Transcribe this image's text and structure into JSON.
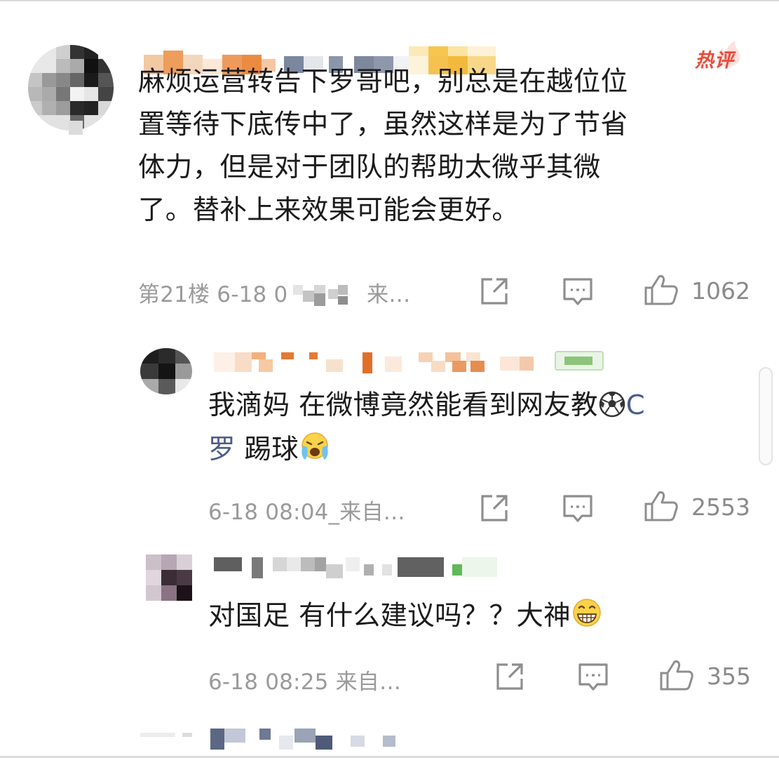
{
  "badge": {
    "hot_label": "热评"
  },
  "main_comment": {
    "text_lines": [
      "麻烦运营转告下罗哥吧，别总是在越位位",
      "置等待下底传中了，虽然这样是为了节省",
      "体力，但是对于团队的帮助太微乎其微",
      "了。替补上来效果可能会更好。"
    ],
    "meta": "第21楼 6-18 0",
    "meta_suffix": "来…",
    "like_count": "1062"
  },
  "replies": [
    {
      "text_line1_before": "我滴妈  在微博竟然能看到网友教",
      "mention_tail": "C",
      "mention_head": "罗",
      "text_line2_after": " 踢球",
      "meta": "6-18 08:04_来自…",
      "like_count": "2553"
    },
    {
      "text": "对国足 有什么建议吗？？大神",
      "meta": "6-18 08:25 来自…",
      "like_count": "355"
    }
  ],
  "icons": {
    "share": "share-icon",
    "comment": "comment-icon",
    "like": "thumbs-up-icon",
    "soccer": "soccer-ball-emoji",
    "crying": "crying-face-emoji",
    "grin": "grinning-face-emoji"
  },
  "colors": {
    "text": "#1b1b1b",
    "meta": "#9a9a9a",
    "hot": "#e94a3c",
    "mention": "#4a5c8e"
  }
}
